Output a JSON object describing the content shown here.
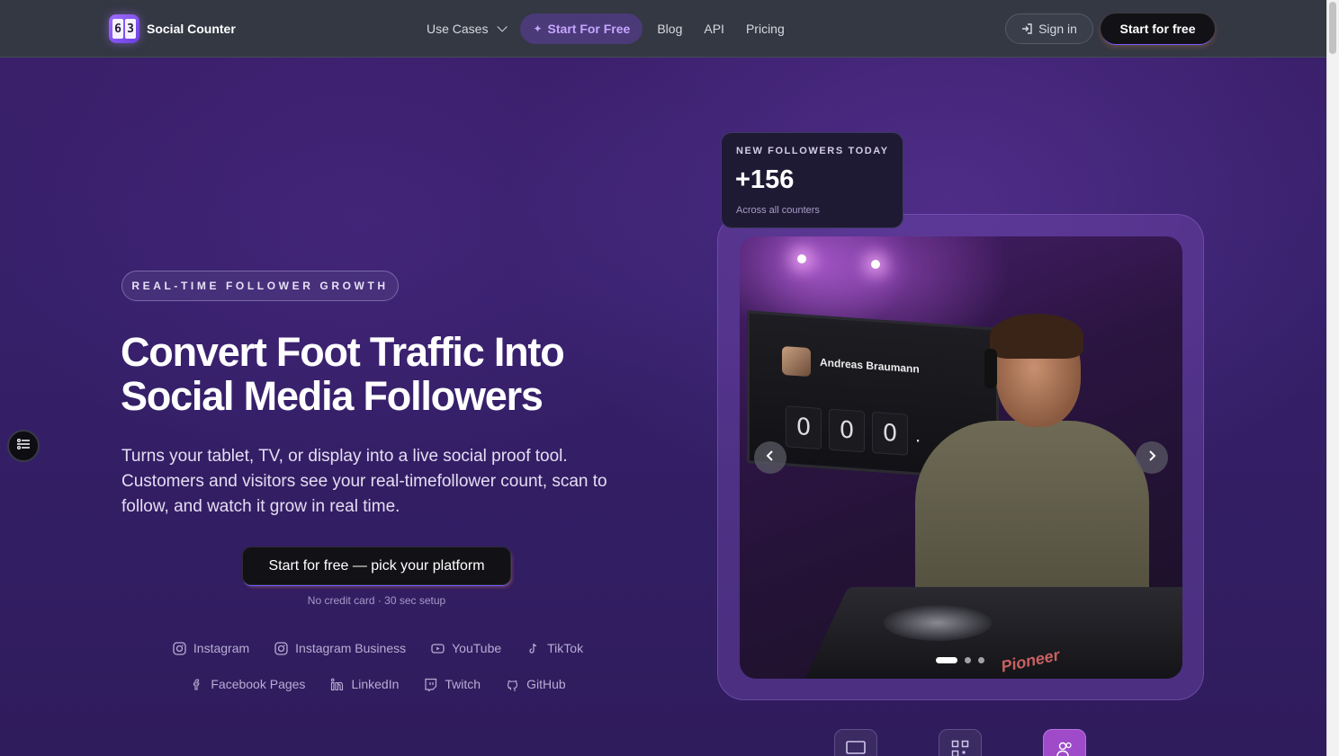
{
  "nav": {
    "logo_digits": [
      "6",
      "3"
    ],
    "logo_text": "Social Counter",
    "links": {
      "use_cases": "Use Cases",
      "start_for_free": "Start For Free",
      "blog": "Blog",
      "api": "API",
      "pricing": "Pricing"
    },
    "sign_in": "Sign in",
    "start_button": "Start for free"
  },
  "hero": {
    "badge": "REAL-TIME FOLLOWER GROWTH",
    "title_line1": "Convert Foot Traffic Into",
    "title_line2": "Social Media Followers",
    "description": "Turns your tablet, TV, or display into a live social proof tool. Customers and visitors see your real-timefollower count, scan to follow, and watch it grow in real time.",
    "cta": "Start for free — pick your platform",
    "cta_sub": "No credit card · 30 sec setup",
    "platforms_row1": [
      "Instagram",
      "Instagram Business",
      "YouTube",
      "TikTok"
    ],
    "platforms_row2": [
      "Facebook Pages",
      "LinkedIn",
      "Twitch",
      "GitHub"
    ]
  },
  "stats_card": {
    "label": "NEW FOLLOWERS TODAY",
    "value": "+156",
    "sub": "Across all counters"
  },
  "carousel": {
    "screen_name": "Andreas Braumann",
    "screen_digits": [
      "0",
      "0",
      "0"
    ],
    "brand": "Pioneer",
    "slide_count": 3,
    "active_slide": 1
  },
  "colors": {
    "accent": "#9e4ac9",
    "nav_bg": "#343843",
    "pill_text": "#c6a6ff"
  }
}
